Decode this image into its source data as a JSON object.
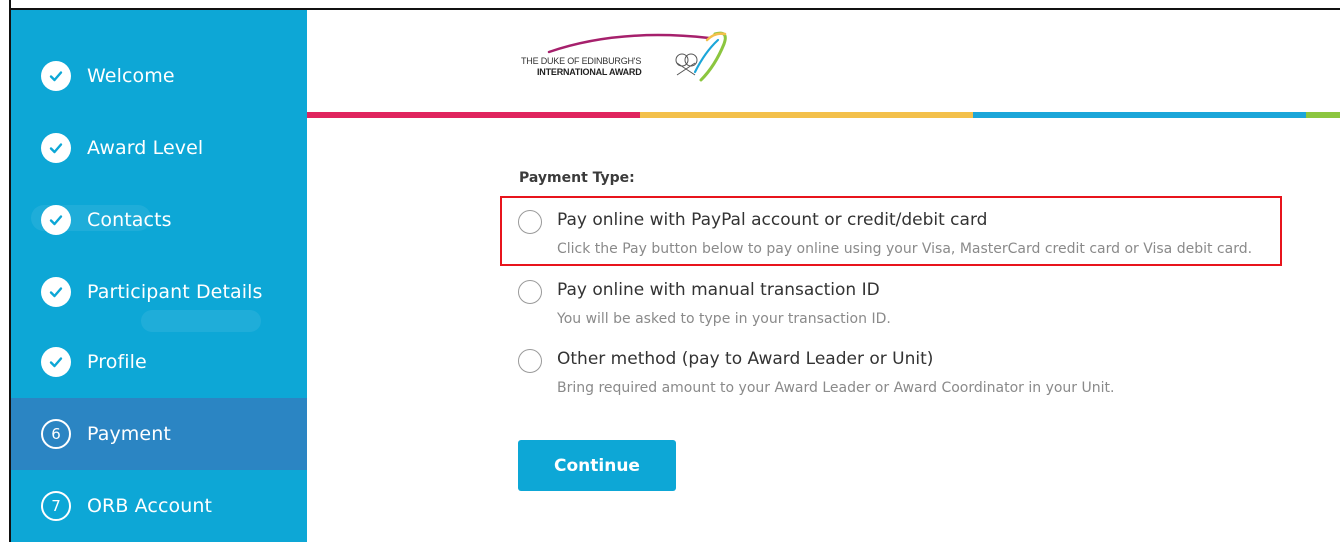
{
  "sidebar": {
    "items": [
      {
        "label": "Welcome",
        "state": "done",
        "icon": "check-icon"
      },
      {
        "label": "Award Level",
        "state": "done",
        "icon": "check-icon"
      },
      {
        "label": "Contacts",
        "state": "done",
        "icon": "check-icon"
      },
      {
        "label": "Participant Details",
        "state": "done",
        "icon": "check-icon"
      },
      {
        "label": "Profile",
        "state": "done",
        "icon": "check-icon"
      },
      {
        "label": "Payment",
        "state": "active",
        "number": "6"
      },
      {
        "label": "ORB Account",
        "state": "pending",
        "number": "7"
      }
    ]
  },
  "header": {
    "logo_line1": "THE DUKE OF EDINBURGH'S",
    "logo_line2": "INTERNATIONAL AWARD",
    "stripe_colors": [
      "#e0245e",
      "#f3c04b",
      "#1ba6d9",
      "#8cc63f"
    ]
  },
  "payment": {
    "label": "Payment Type:",
    "options": [
      {
        "title": "Pay online with PayPal account or credit/debit card",
        "description": "Click the Pay button below to pay online using your Visa, MasterCard credit card or Visa debit card.",
        "highlighted": true
      },
      {
        "title": "Pay online with manual transaction ID",
        "description": "You will be asked to type in your transaction ID."
      },
      {
        "title": "Other method (pay to Award Leader or Unit)",
        "description": "Bring required amount to your Award Leader or Award Coordinator in your Unit."
      }
    ],
    "continue_label": "Continue"
  },
  "colors": {
    "sidebar": "#0da7d6",
    "sidebar_active": "#2b85c3",
    "highlight": "#e8141c",
    "button": "#0da7d6"
  }
}
